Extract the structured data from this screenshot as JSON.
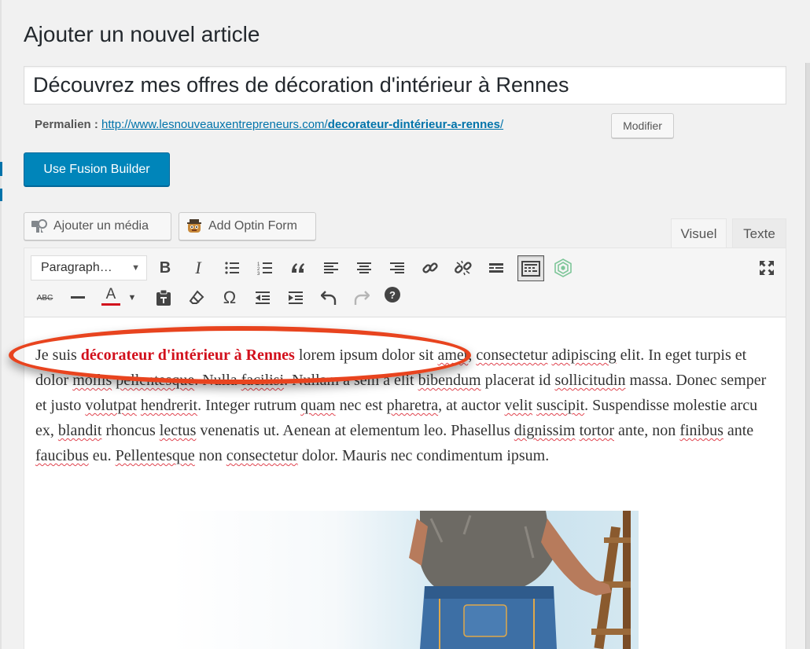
{
  "page": {
    "title": "Ajouter un nouvel article",
    "post_title": "Découvrez mes offres de décoration d'intérieur à Rennes"
  },
  "permalink": {
    "label": "Permalien :",
    "url_base": "http://www.lesnouveauxentrepreneurs.com/",
    "slug": "decorateur-dintérieur-a-rennes",
    "edit_button": "Modifier"
  },
  "buttons": {
    "fusion_builder": "Use Fusion Builder",
    "add_media": "Ajouter un média",
    "add_optin": "Add Optin Form"
  },
  "tabs": {
    "visual": "Visuel",
    "text": "Texte"
  },
  "toolbar": {
    "format_select": "Paragraph…",
    "row1_icons": [
      "bold-icon",
      "italic-icon",
      "bullet-list-icon",
      "numbered-list-icon",
      "blockquote-icon",
      "align-left-icon",
      "align-center-icon",
      "align-right-icon",
      "link-icon",
      "unlink-icon",
      "read-more-icon",
      "toolbar-toggle-icon",
      "fusion-shortcode-icon",
      "fullscreen-icon"
    ],
    "row2_icons": [
      "strikethrough-icon",
      "horizontal-line-icon",
      "text-color-icon",
      "paste-as-text-icon",
      "clear-formatting-icon",
      "special-character-icon",
      "outdent-icon",
      "indent-icon",
      "undo-icon",
      "redo-icon",
      "help-icon"
    ],
    "bold_glyph": "B",
    "italic_glyph": "I",
    "text_color_glyph": "A",
    "strike_glyph": "ABC",
    "omega_glyph": "Ω",
    "help_glyph": "?"
  },
  "colors": {
    "accent_blue": "#0085ba",
    "highlight_red": "#d2101c",
    "annotation_orange": "#e8441f",
    "text_color_bar": "#d2101c"
  },
  "content": {
    "p1": "Je suis ",
    "p2": "décorateur d'intérieur à Rennes",
    "p3": " lorem ipsum dolor sit ",
    "w_amet": "amet",
    "p4": ", ",
    "w_consectetur": "consectetur",
    "p5": " ",
    "w_adipiscing": "adipiscing",
    "p6": " elit. In eget turpis et dolor ",
    "w_mollis": "mollis",
    "p7": " ",
    "w_pellentesque": "pellentesque",
    "p8": ". Nulla ",
    "w_facilisi": "facilisi",
    "p9": ". Nullam a sem a elit ",
    "w_bibendum": "bibendum",
    "p10": " placerat id ",
    "w_sollicitudin": "sollicitudin",
    "p11": " massa. Donec semper et justo ",
    "w_volutpat": "volutpat",
    "p12": " ",
    "w_hendrerit": "hendrerit",
    "p13": ". Integer rutrum ",
    "w_quam": "quam",
    "p14": " nec est ",
    "w_pharetra": "pharetra",
    "p15": ", at auctor ",
    "w_velit": "velit",
    "p16": " ",
    "w_suscipit": "suscipit",
    "p17": ". Suspendisse molestie arcu ex, ",
    "w_blandit": "blandit",
    "p18": " rhoncus ",
    "w_lectus": "lectus",
    "p19": " venenatis ut. Aenean at elementum leo. Phasellus ",
    "w_dignissim": "dignissim",
    "p20": " ",
    "w_tortor": "tortor",
    "p21": " ante, non ",
    "w_finibus": "finibus",
    "p22": " ante ",
    "w_faucibus": "faucibus",
    "p23": " eu. ",
    "w_pellentesque2": "Pellentesque",
    "p24": " non ",
    "w_consectetur2": "consectetur",
    "p25": " dolor. Mauris nec condimentum ipsum."
  }
}
